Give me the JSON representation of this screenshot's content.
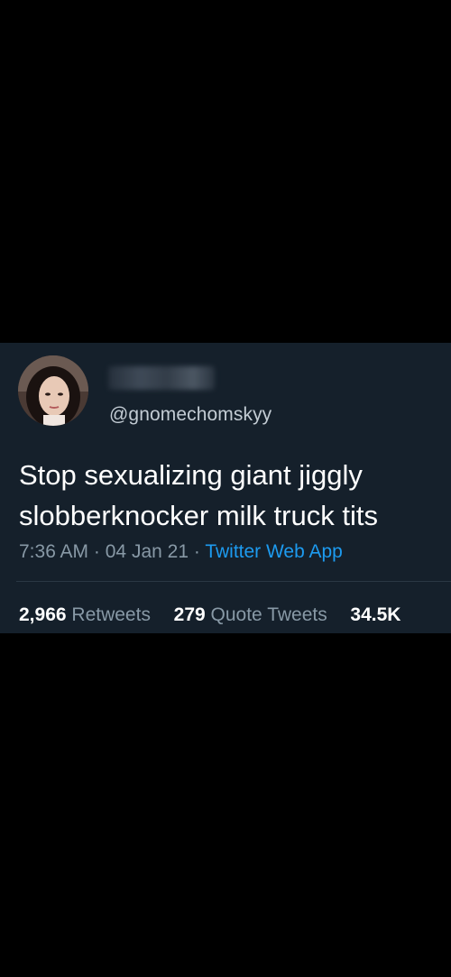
{
  "tweet": {
    "handle": "@gnomechomskyy",
    "text": "Stop sexualizing giant jiggly slobberknocker milk truck tits",
    "time": "7:36 AM",
    "date": "04 Jan 21",
    "separator": "·",
    "source": "Twitter Web App",
    "stats": {
      "retweets_count": "2,966",
      "retweets_label": "Retweets",
      "quote_count": "279",
      "quote_label": "Quote Tweets",
      "likes_count": "34.5K"
    }
  },
  "colors": {
    "background": "#000000",
    "card": "#15202b",
    "text_primary": "#ffffff",
    "text_secondary": "#8899a6",
    "link": "#1d9bf0"
  },
  "icons": {
    "avatar": "profile-photo"
  }
}
